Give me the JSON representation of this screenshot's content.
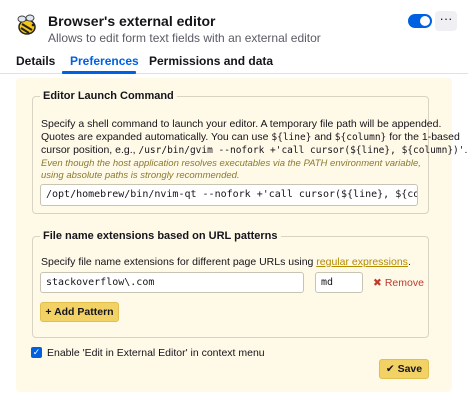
{
  "header": {
    "title": "Browser's external editor",
    "description": "Allows to edit form text fields with an external editor",
    "logo_icon": "bee-logo-icon",
    "enabled": true,
    "more_label": "···"
  },
  "tabs": [
    {
      "label": "Details",
      "active": false
    },
    {
      "label": "Preferences",
      "active": true
    },
    {
      "label": "Permissions and data",
      "active": false
    }
  ],
  "launch": {
    "legend": "Editor Launch Command",
    "line1": "Specify a shell command to launch your editor. A temporary file path will be appended.",
    "line2a": "Quotes are expanded automatically. You can use ",
    "line2b": "${line}",
    "line2c": " and ",
    "line2d": "${column}",
    "line2e": " for the 1-based",
    "line3a": "cursor position, e.g., ",
    "line3b": "/usr/bin/gvim --nofork +'call cursor(${line}, ${column})'",
    "line3c": ".",
    "note": "Even though the host application resolves executables via the PATH environment variable, using absolute paths is strongly recommended.",
    "command_value": "/opt/homebrew/bin/nvim-qt --nofork +'call cursor(${line}, ${column})"
  },
  "extensions": {
    "legend": "File name extensions based on URL patterns",
    "desc_a": "Specify file name extensions for different page URLs using ",
    "desc_link": "regular expressions",
    "desc_b": ".",
    "pattern_value": "stackoverflow\\.com",
    "extension_value": "md",
    "remove_label": "Remove",
    "add_label": "+ Add Pattern"
  },
  "context_menu": {
    "checked": true,
    "label": "Enable 'Edit in External Editor' in context menu"
  },
  "save_label": "✔ Save",
  "colors": {
    "accent": "#0061e0",
    "panel_bg": "#fff9e8",
    "button_yellow": "#f2d165",
    "remove_red": "#c0392b",
    "note_text": "#8a7a30"
  }
}
